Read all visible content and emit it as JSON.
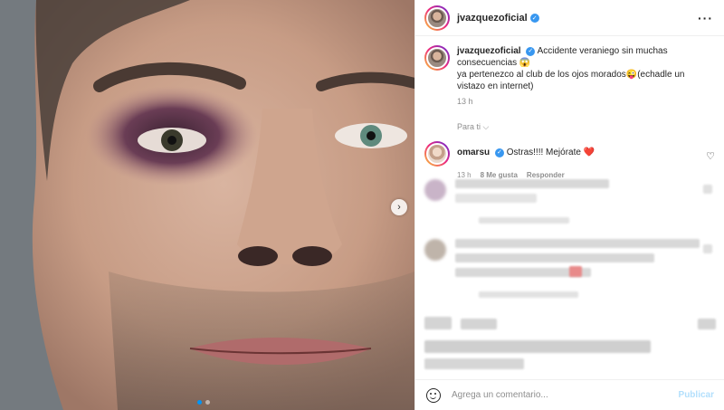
{
  "post": {
    "username": "jvazquezoficial",
    "more_icon": "more-horizontal-icon",
    "carousel_dots": 2,
    "carousel_active_index": 0
  },
  "caption": {
    "username": "jvazquezoficial",
    "line1": "Accidente veraniego sin muchas consecuencias 😱",
    "line2": "ya pertenezco al club de los ojos morados😜(echadle un vistazo en internet)",
    "time": "13 h",
    "for_you": "Para ti ⌵"
  },
  "comments": [
    {
      "username": "omarsu",
      "text": "Ostras!!!! Mejórate ❤️",
      "time": "13 h",
      "likes": "8 Me gusta",
      "reply": "Responder"
    }
  ],
  "footer": {
    "placeholder": "Agrega un comentario...",
    "publish": "Publicar"
  },
  "colors": {
    "accent": "#0095f6",
    "verified": "#3897f0",
    "muted": "#8e8e8e",
    "publish_disabled": "#b2dffc"
  }
}
